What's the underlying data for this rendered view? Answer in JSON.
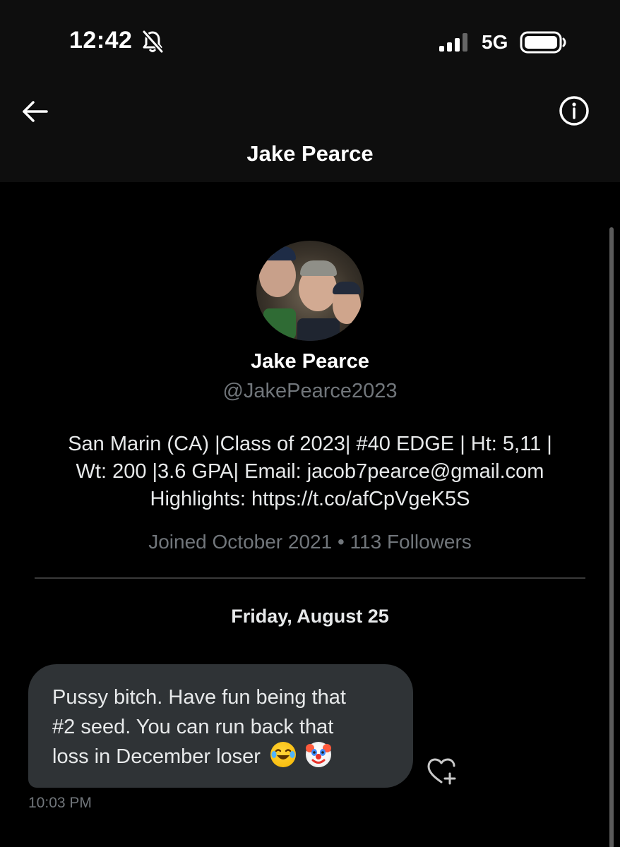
{
  "status_bar": {
    "time": "12:42",
    "network": "5G",
    "icons": [
      "bell-slash-icon",
      "signal-icon",
      "battery-icon"
    ]
  },
  "header": {
    "title": "Jake Pearce",
    "icons": [
      "back-arrow-icon",
      "info-icon"
    ]
  },
  "profile": {
    "name": "Jake Pearce",
    "handle": "@JakePearce2023",
    "bio_lines": [
      "San Marin (CA) |Class of 2023| #40 EDGE | Ht: 5,11 |",
      "Wt: 200 |3.6 GPA| Email: jacob7pearce@gmail.com",
      "Highlights: https://t.co/afCpVgeK5S"
    ],
    "meta": "Joined October 2021 • 113 Followers"
  },
  "conversation": {
    "date_separator": "Friday, August 25",
    "messages": [
      {
        "lines": [
          "Pussy bitch. Have fun being that",
          "#2 seed. You can run back that",
          "loss in December loser"
        ],
        "emojis": [
          "face-with-tears-of-joy-icon",
          "clown-face-icon"
        ],
        "time": "10:03 PM"
      }
    ],
    "reaction_icon": "heart-plus-icon"
  },
  "colors": {
    "background": "#000000",
    "bubble": "#2f3336",
    "secondary_text": "#71767b",
    "primary_text": "#e7e9ea"
  }
}
